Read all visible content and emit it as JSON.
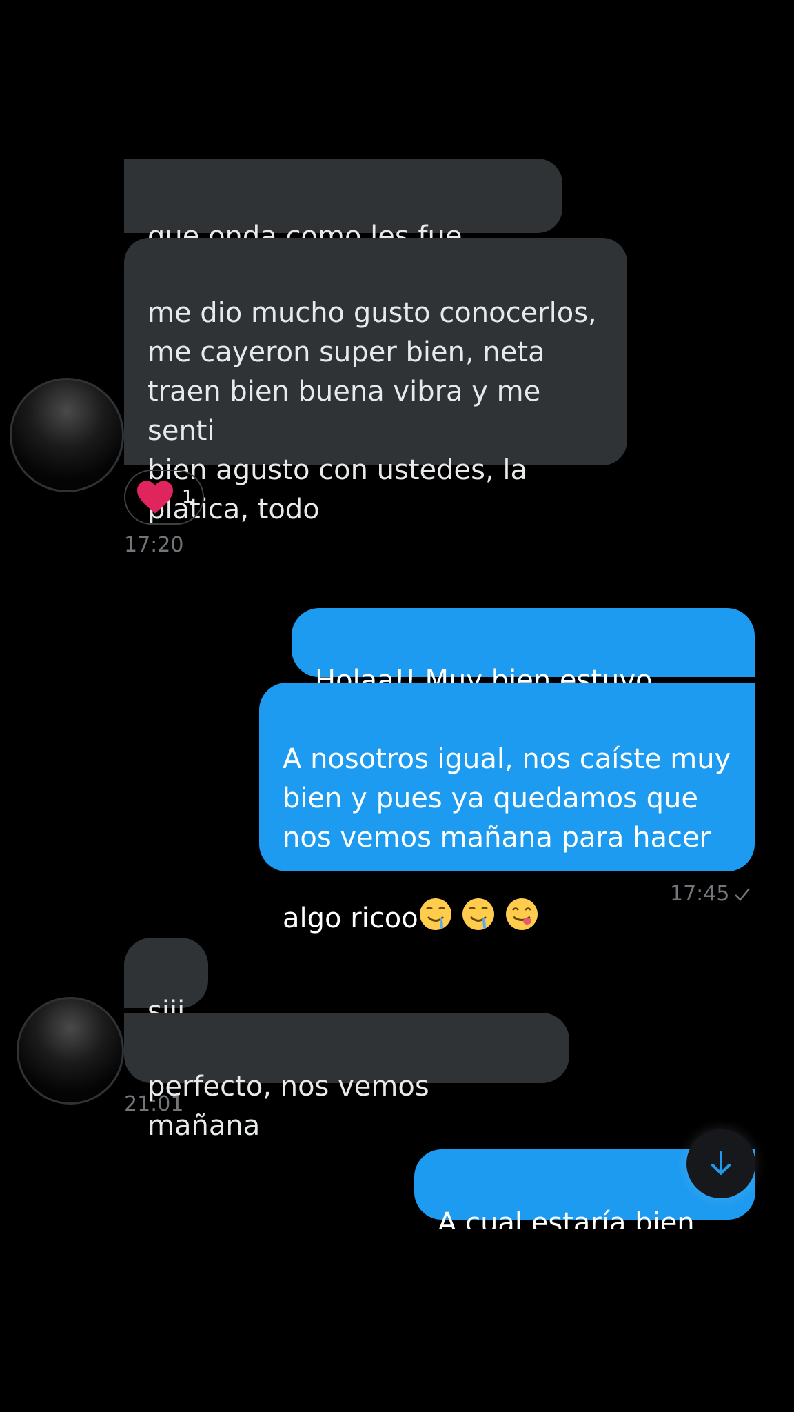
{
  "messages": {
    "m1_text": "que onda como les fue ayer?",
    "m2_text": "me dio mucho gusto conocerlos,\nme cayeron super bien, neta\ntraen bien buena vibra y me senti\nbien agusto con ustedes, la\nplatica, todo",
    "m2_reaction_count": "1",
    "m2_time": "17:20",
    "m3_text": "Holaa!! Muy bien estuvo padre",
    "m4_text_lines": "A nosotros igual, nos caíste muy\nbien y pues ya quedamos que\nnos vemos mañana para hacer",
    "m4_last_line": "algo ricoo",
    "m4_time": "17:45",
    "m5_text": "siii",
    "m6_text": "perfecto, nos vemos mañana",
    "m6_time": "21:01",
    "m7_text": "A cual estaría bien"
  },
  "icons": {
    "reaction": "heart-icon",
    "read_receipt": "checkmark-icon",
    "scroll_down": "arrow-down-icon",
    "emojis": [
      "drooling-face-icon",
      "drooling-face-icon",
      "savoring-face-icon"
    ]
  },
  "colors": {
    "background": "#000000",
    "incoming_bubble": "#2f3336",
    "outgoing_bubble": "#1d9bf0",
    "timestamp": "#71767b",
    "heart": "#f91880"
  }
}
